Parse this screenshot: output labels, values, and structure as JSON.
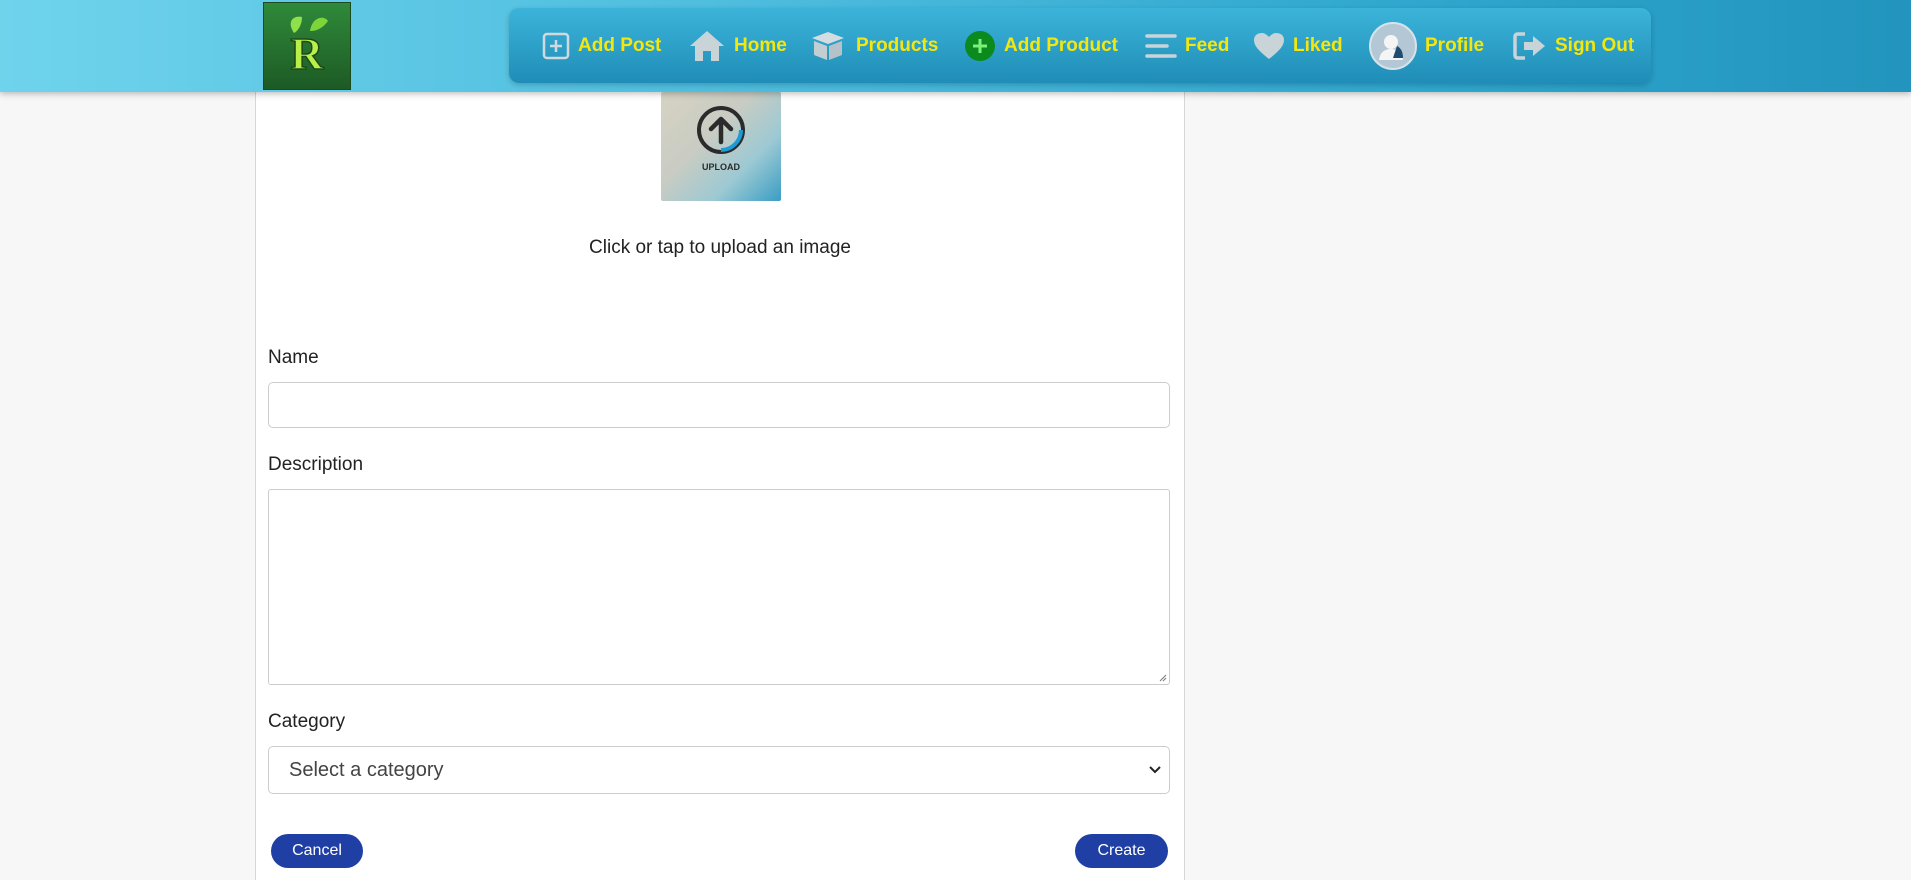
{
  "nav": {
    "add_post": "Add Post",
    "home": "Home",
    "products": "Products",
    "add_product": "Add Product",
    "feed": "Feed",
    "liked": "Liked",
    "profile": "Profile",
    "sign_out": "Sign Out"
  },
  "upload": {
    "image_text": "UPLOAD",
    "caption": "Click or tap to upload an image"
  },
  "form": {
    "name_label": "Name",
    "name_value": "",
    "description_label": "Description",
    "description_value": "",
    "category_label": "Category",
    "category_selected": "Select a category"
  },
  "actions": {
    "cancel": "Cancel",
    "create": "Create"
  },
  "colors": {
    "nav_text": "#f3e70f",
    "button": "#1f3fa5",
    "add_product_icon": "#0b8a1e"
  },
  "logo": {
    "letter": "R"
  }
}
